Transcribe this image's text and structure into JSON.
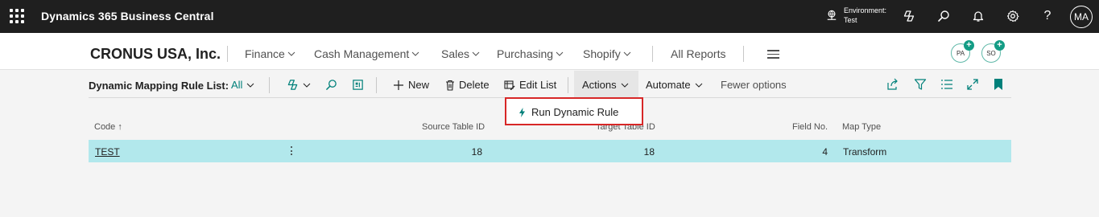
{
  "topbar": {
    "app_title": "Dynamics 365 Business Central",
    "environment_label": "Environment:",
    "environment_value": "Test",
    "avatar_initials": "MA",
    "icons": [
      "waffle-icon",
      "environment-icon",
      "copilot-icon",
      "search-icon",
      "bell-icon",
      "gear-icon",
      "help-icon"
    ]
  },
  "nav": {
    "company": "CRONUS USA, Inc.",
    "items": [
      "Finance",
      "Cash Management",
      "Sales",
      "Purchasing",
      "Shopify"
    ],
    "all_reports": "All Reports",
    "bubbles": [
      "PA",
      "SO"
    ]
  },
  "actionbar": {
    "list_title": "Dynamic Mapping Rule List:",
    "view_filter": "All",
    "new_label": "New",
    "delete_label": "Delete",
    "edit_list_label": "Edit List",
    "actions_label": "Actions",
    "automate_label": "Automate",
    "fewer_options_label": "Fewer options"
  },
  "dropdown": {
    "run_rule_label": "Run Dynamic Rule"
  },
  "table": {
    "columns": {
      "code": "Code ↑",
      "source_table_id": "Source Table ID",
      "target_table_id": "Target Table ID",
      "field_no": "Field No.",
      "map_type": "Map Type"
    },
    "rows": [
      {
        "code": "TEST",
        "source_table_id": "18",
        "target_table_id": "18",
        "field_no": "4",
        "map_type": "Transform"
      }
    ]
  },
  "colors": {
    "topbar_bg": "#1f1f1f",
    "accent": "#00807a",
    "selected_row": "#b2e8ec",
    "highlight_border": "#d72727"
  }
}
